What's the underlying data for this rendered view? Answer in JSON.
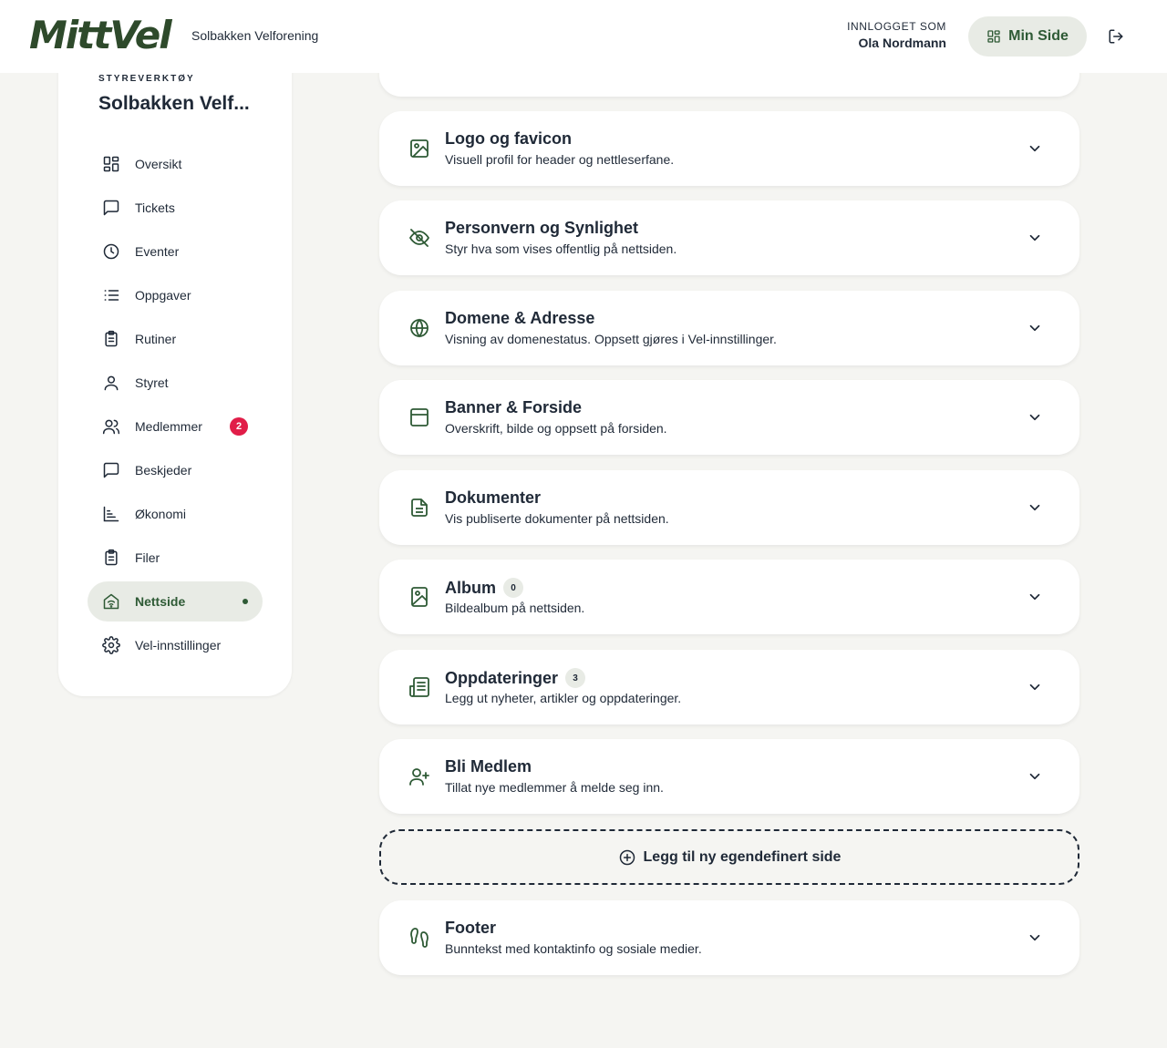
{
  "header": {
    "logo_text": "MittVel",
    "org_name": "Solbakken Velforening",
    "logged_in_label": "INNLOGGET SOM",
    "user_name": "Ola Nordmann",
    "min_side_label": "Min Side"
  },
  "sidebar": {
    "eyebrow": "STYREVERKTØY",
    "title": "Solbakken Velf...",
    "items": [
      {
        "label": "Oversikt",
        "icon": "grid-icon"
      },
      {
        "label": "Tickets",
        "icon": "chat-icon"
      },
      {
        "label": "Eventer",
        "icon": "clock-icon"
      },
      {
        "label": "Oppgaver",
        "icon": "list-icon"
      },
      {
        "label": "Rutiner",
        "icon": "clipboard-icon"
      },
      {
        "label": "Styret",
        "icon": "user-icon"
      },
      {
        "label": "Medlemmer",
        "icon": "users-icon",
        "badge": "2"
      },
      {
        "label": "Beskjeder",
        "icon": "chat-icon"
      },
      {
        "label": "Økonomi",
        "icon": "chart-icon"
      },
      {
        "label": "Filer",
        "icon": "clipboard-icon"
      },
      {
        "label": "Nettside",
        "icon": "home-wifi-icon",
        "active": true
      },
      {
        "label": "Vel-innstillinger",
        "icon": "gear-icon"
      }
    ]
  },
  "sections": [
    {
      "title": "Logo og favicon",
      "desc": "Visuell profil for header og nettleserfane.",
      "icon": "image-icon"
    },
    {
      "title": "Personvern og Synlighet",
      "desc": "Styr hva som vises offentlig på nettsiden.",
      "icon": "eye-off-icon"
    },
    {
      "title": "Domene & Adresse",
      "desc": "Visning av domenestatus. Oppsett gjøres i Vel-innstillinger.",
      "icon": "globe-icon"
    },
    {
      "title": "Banner & Forside",
      "desc": "Overskrift, bilde og oppsett på forsiden.",
      "icon": "layout-icon"
    },
    {
      "title": "Dokumenter",
      "desc": "Vis publiserte dokumenter på nettsiden.",
      "icon": "document-icon"
    },
    {
      "title": "Album",
      "desc": "Bildealbum på nettsiden.",
      "icon": "album-icon",
      "count": "0"
    },
    {
      "title": "Oppdateringer",
      "desc": "Legg ut nyheter, artikler og oppdateringer.",
      "icon": "newspaper-icon",
      "count": "3"
    },
    {
      "title": "Bli Medlem",
      "desc": "Tillat nye medlemmer å melde seg inn.",
      "icon": "user-plus-icon"
    }
  ],
  "add_page_label": "Legg til ny egendefinert side",
  "footer_section": {
    "title": "Footer",
    "desc": "Bunntekst med kontaktinfo og sosiale medier.",
    "icon": "footprints-icon"
  },
  "colors": {
    "brand": "#2e4a2b",
    "accent": "#2e5a35",
    "badge": "#e11d48",
    "background": "#f5f5f2"
  }
}
